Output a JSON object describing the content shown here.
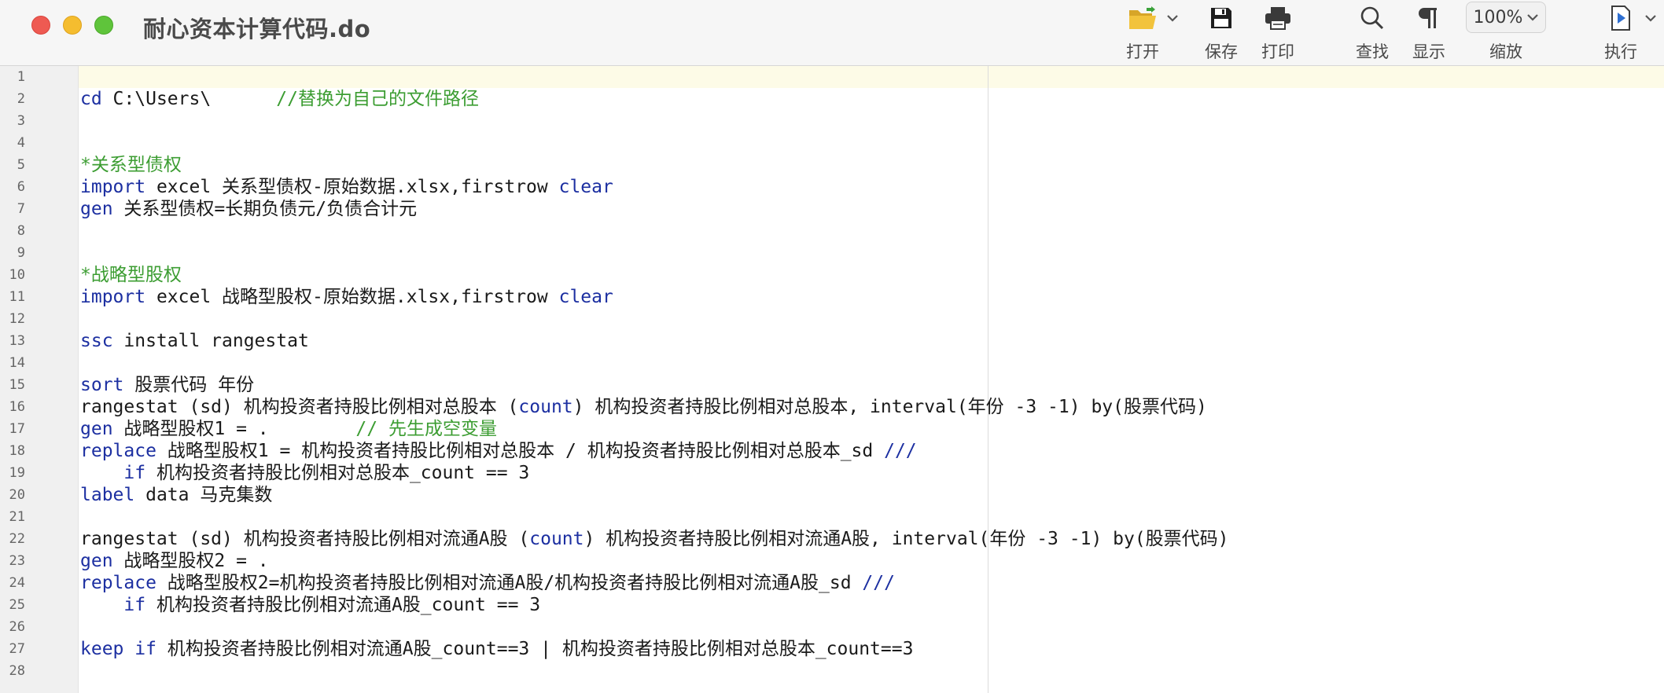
{
  "window": {
    "title": "耐心资本计算代码.do"
  },
  "toolbar": {
    "open_label": "打开",
    "save_label": "保存",
    "print_label": "打印",
    "find_label": "查找",
    "display_label": "显示",
    "zoom_label": "缩放",
    "zoom_value": "100%",
    "run_label": "执行"
  },
  "editor": {
    "line_numbers": [
      "1",
      "2",
      "3",
      "4",
      "5",
      "6",
      "7",
      "8",
      "9",
      "10",
      "11",
      "12",
      "13",
      "14",
      "15",
      "16",
      "17",
      "18",
      "19",
      "20",
      "21",
      "22",
      "23",
      "24",
      "25",
      "26",
      "27",
      "28"
    ],
    "colors": {
      "keyword": "#1c2fa1",
      "comment": "#3c9d32",
      "text": "#1a1a1a"
    },
    "lines": [
      [],
      [
        {
          "t": "kw",
          "v": "cd"
        },
        {
          "t": "tx",
          "v": " C:\\Users\\      "
        },
        {
          "t": "cm",
          "v": "//替换为自己的文件路径"
        }
      ],
      [],
      [],
      [
        {
          "t": "cm",
          "v": "*关系型债权"
        }
      ],
      [
        {
          "t": "kw",
          "v": "import"
        },
        {
          "t": "tx",
          "v": " excel 关系型债权-原始数据.xlsx,firstrow "
        },
        {
          "t": "kw",
          "v": "clear"
        }
      ],
      [
        {
          "t": "kw",
          "v": "gen"
        },
        {
          "t": "tx",
          "v": " 关系型债权=长期负债元/负债合计元"
        }
      ],
      [],
      [],
      [
        {
          "t": "cm",
          "v": "*战略型股权"
        }
      ],
      [
        {
          "t": "kw",
          "v": "import"
        },
        {
          "t": "tx",
          "v": " excel 战略型股权-原始数据.xlsx,firstrow "
        },
        {
          "t": "kw",
          "v": "clear"
        }
      ],
      [],
      [
        {
          "t": "kw",
          "v": "ssc"
        },
        {
          "t": "tx",
          "v": " install rangestat"
        }
      ],
      [],
      [
        {
          "t": "kw",
          "v": "sort"
        },
        {
          "t": "tx",
          "v": " 股票代码 年份"
        }
      ],
      [
        {
          "t": "tx",
          "v": "rangestat (sd) 机构投资者持股比例相对总股本 ("
        },
        {
          "t": "kw",
          "v": "count"
        },
        {
          "t": "tx",
          "v": ") 机构投资者持股比例相对总股本, interval(年份 -3 -1) by(股票代码)"
        }
      ],
      [
        {
          "t": "kw",
          "v": "gen"
        },
        {
          "t": "tx",
          "v": " 战略型股权1 = .        "
        },
        {
          "t": "cm",
          "v": "// 先生成空变量"
        }
      ],
      [
        {
          "t": "kw",
          "v": "replace"
        },
        {
          "t": "tx",
          "v": " 战略型股权1 = 机构投资者持股比例相对总股本 / 机构投资者持股比例相对总股本_sd "
        },
        {
          "t": "kw",
          "v": "///"
        }
      ],
      [
        {
          "t": "tx",
          "v": "    "
        },
        {
          "t": "kw",
          "v": "if"
        },
        {
          "t": "tx",
          "v": " 机构投资者持股比例相对总股本_count == 3"
        }
      ],
      [
        {
          "t": "kw",
          "v": "label"
        },
        {
          "t": "tx",
          "v": " data 马克集数"
        }
      ],
      [],
      [
        {
          "t": "tx",
          "v": "rangestat (sd) 机构投资者持股比例相对流通A股 ("
        },
        {
          "t": "kw",
          "v": "count"
        },
        {
          "t": "tx",
          "v": ") 机构投资者持股比例相对流通A股, interval(年份 -3 -1) by(股票代码)"
        }
      ],
      [
        {
          "t": "kw",
          "v": "gen"
        },
        {
          "t": "tx",
          "v": " 战略型股权2 = ."
        }
      ],
      [
        {
          "t": "kw",
          "v": "replace"
        },
        {
          "t": "tx",
          "v": " 战略型股权2=机构投资者持股比例相对流通A股/机构投资者持股比例相对流通A股_sd "
        },
        {
          "t": "kw",
          "v": "///"
        }
      ],
      [
        {
          "t": "tx",
          "v": "    "
        },
        {
          "t": "kw",
          "v": "if"
        },
        {
          "t": "tx",
          "v": " 机构投资者持股比例相对流通A股_count == 3"
        }
      ],
      [],
      [
        {
          "t": "kw",
          "v": "keep"
        },
        {
          "t": "tx",
          "v": " "
        },
        {
          "t": "kw",
          "v": "if"
        },
        {
          "t": "tx",
          "v": " 机构投资者持股比例相对流通A股_count==3 | 机构投资者持股比例相对总股本_count==3"
        }
      ],
      []
    ]
  }
}
